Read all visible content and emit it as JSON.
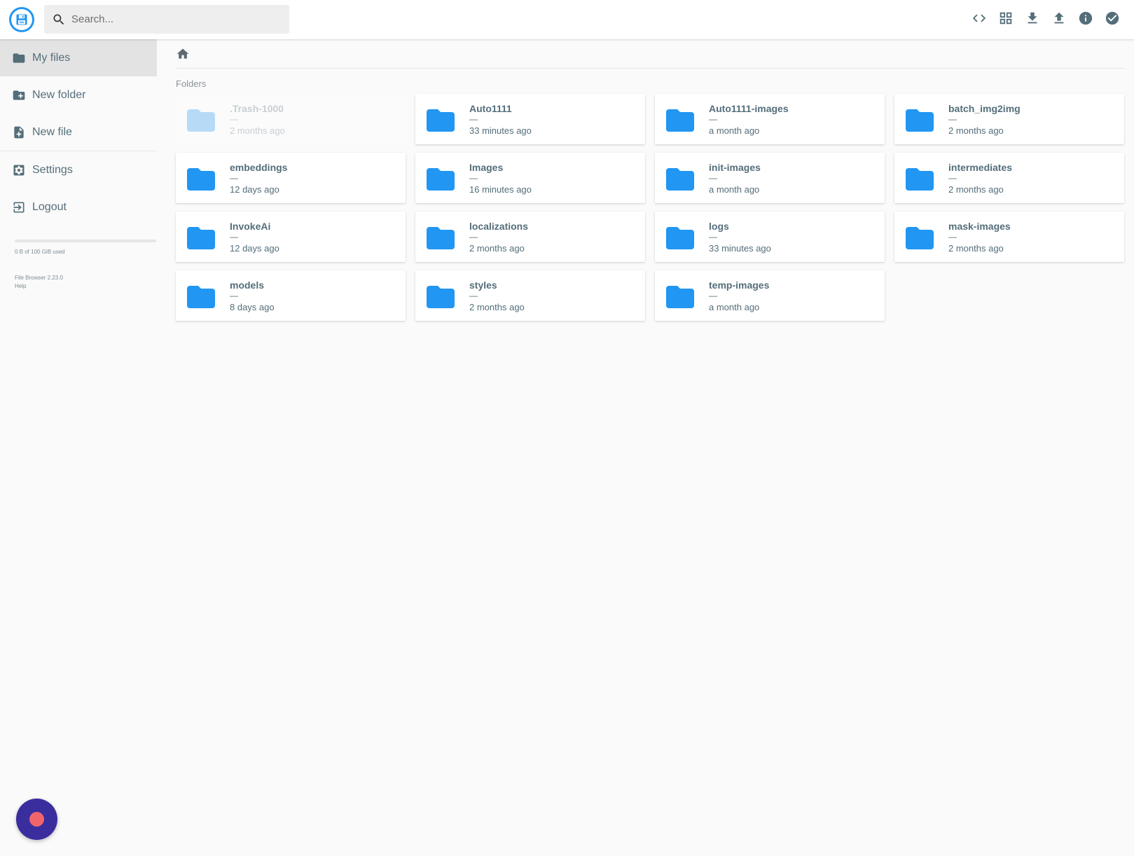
{
  "header": {
    "search_placeholder": "Search...",
    "actions": [
      {
        "icon": "code-icon",
        "label": "Toggle shell"
      },
      {
        "icon": "grid-view-icon",
        "label": "Switch view"
      },
      {
        "icon": "download-icon",
        "label": "Download"
      },
      {
        "icon": "upload-icon",
        "label": "Upload"
      },
      {
        "icon": "info-icon",
        "label": "Info"
      },
      {
        "icon": "check-circle-icon",
        "label": "Select multiple"
      }
    ]
  },
  "sidebar": {
    "items": [
      {
        "label": "My files",
        "icon": "folder-icon"
      },
      {
        "label": "New folder",
        "icon": "create-new-folder-icon"
      },
      {
        "label": "New file",
        "icon": "note-add-icon"
      },
      {
        "label": "Settings",
        "icon": "settings-icon"
      },
      {
        "label": "Logout",
        "icon": "logout-icon"
      }
    ],
    "quota_text": "0 B of 100 GiB used",
    "version": "File Browser 2.23.0",
    "help": "Help"
  },
  "main": {
    "section_title": "Folders",
    "size_placeholder": "—",
    "folders": [
      {
        "name": ".Trash-1000",
        "size": "—",
        "modified": "2 months ago",
        "dimmed": true
      },
      {
        "name": "Auto1111",
        "size": "—",
        "modified": "33 minutes ago"
      },
      {
        "name": "Auto1111-images",
        "size": "—",
        "modified": "a month ago"
      },
      {
        "name": "batch_img2img",
        "size": "—",
        "modified": "2 months ago"
      },
      {
        "name": "embeddings",
        "size": "—",
        "modified": "12 days ago"
      },
      {
        "name": "Images",
        "size": "—",
        "modified": "16 minutes ago"
      },
      {
        "name": "init-images",
        "size": "—",
        "modified": "a month ago"
      },
      {
        "name": "intermediates",
        "size": "—",
        "modified": "2 months ago"
      },
      {
        "name": "InvokeAi",
        "size": "—",
        "modified": "12 days ago"
      },
      {
        "name": "localizations",
        "size": "—",
        "modified": "2 months ago"
      },
      {
        "name": "logs",
        "size": "—",
        "modified": "33 minutes ago"
      },
      {
        "name": "mask-images",
        "size": "—",
        "modified": "2 months ago"
      },
      {
        "name": "models",
        "size": "—",
        "modified": "8 days ago"
      },
      {
        "name": "styles",
        "size": "—",
        "modified": "2 months ago"
      },
      {
        "name": "temp-images",
        "size": "—",
        "modified": "a month ago"
      }
    ]
  },
  "colors": {
    "accent": "#2196f3",
    "text": "#546e7a",
    "fab": "#3a2d9e",
    "fab_dot": "#f0656b"
  }
}
